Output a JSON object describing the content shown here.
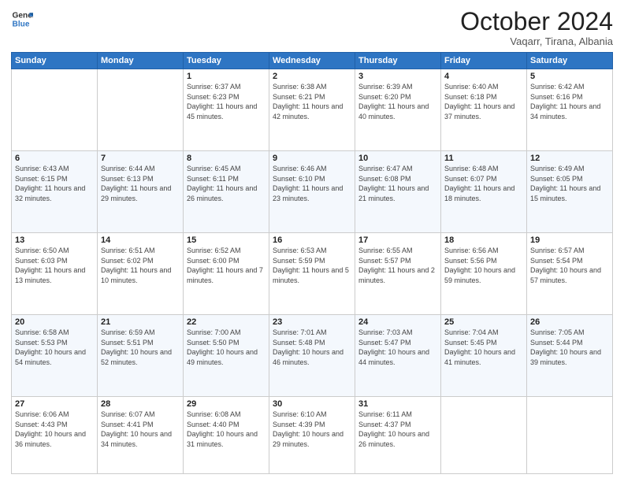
{
  "header": {
    "logo_line1": "General",
    "logo_line2": "Blue",
    "month_title": "October 2024",
    "subtitle": "Vaqarr, Tirana, Albania"
  },
  "weekdays": [
    "Sunday",
    "Monday",
    "Tuesday",
    "Wednesday",
    "Thursday",
    "Friday",
    "Saturday"
  ],
  "weeks": [
    [
      {
        "day": "",
        "sunrise": "",
        "sunset": "",
        "daylight": ""
      },
      {
        "day": "",
        "sunrise": "",
        "sunset": "",
        "daylight": ""
      },
      {
        "day": "1",
        "sunrise": "Sunrise: 6:37 AM",
        "sunset": "Sunset: 6:23 PM",
        "daylight": "Daylight: 11 hours and 45 minutes."
      },
      {
        "day": "2",
        "sunrise": "Sunrise: 6:38 AM",
        "sunset": "Sunset: 6:21 PM",
        "daylight": "Daylight: 11 hours and 42 minutes."
      },
      {
        "day": "3",
        "sunrise": "Sunrise: 6:39 AM",
        "sunset": "Sunset: 6:20 PM",
        "daylight": "Daylight: 11 hours and 40 minutes."
      },
      {
        "day": "4",
        "sunrise": "Sunrise: 6:40 AM",
        "sunset": "Sunset: 6:18 PM",
        "daylight": "Daylight: 11 hours and 37 minutes."
      },
      {
        "day": "5",
        "sunrise": "Sunrise: 6:42 AM",
        "sunset": "Sunset: 6:16 PM",
        "daylight": "Daylight: 11 hours and 34 minutes."
      }
    ],
    [
      {
        "day": "6",
        "sunrise": "Sunrise: 6:43 AM",
        "sunset": "Sunset: 6:15 PM",
        "daylight": "Daylight: 11 hours and 32 minutes."
      },
      {
        "day": "7",
        "sunrise": "Sunrise: 6:44 AM",
        "sunset": "Sunset: 6:13 PM",
        "daylight": "Daylight: 11 hours and 29 minutes."
      },
      {
        "day": "8",
        "sunrise": "Sunrise: 6:45 AM",
        "sunset": "Sunset: 6:11 PM",
        "daylight": "Daylight: 11 hours and 26 minutes."
      },
      {
        "day": "9",
        "sunrise": "Sunrise: 6:46 AM",
        "sunset": "Sunset: 6:10 PM",
        "daylight": "Daylight: 11 hours and 23 minutes."
      },
      {
        "day": "10",
        "sunrise": "Sunrise: 6:47 AM",
        "sunset": "Sunset: 6:08 PM",
        "daylight": "Daylight: 11 hours and 21 minutes."
      },
      {
        "day": "11",
        "sunrise": "Sunrise: 6:48 AM",
        "sunset": "Sunset: 6:07 PM",
        "daylight": "Daylight: 11 hours and 18 minutes."
      },
      {
        "day": "12",
        "sunrise": "Sunrise: 6:49 AM",
        "sunset": "Sunset: 6:05 PM",
        "daylight": "Daylight: 11 hours and 15 minutes."
      }
    ],
    [
      {
        "day": "13",
        "sunrise": "Sunrise: 6:50 AM",
        "sunset": "Sunset: 6:03 PM",
        "daylight": "Daylight: 11 hours and 13 minutes."
      },
      {
        "day": "14",
        "sunrise": "Sunrise: 6:51 AM",
        "sunset": "Sunset: 6:02 PM",
        "daylight": "Daylight: 11 hours and 10 minutes."
      },
      {
        "day": "15",
        "sunrise": "Sunrise: 6:52 AM",
        "sunset": "Sunset: 6:00 PM",
        "daylight": "Daylight: 11 hours and 7 minutes."
      },
      {
        "day": "16",
        "sunrise": "Sunrise: 6:53 AM",
        "sunset": "Sunset: 5:59 PM",
        "daylight": "Daylight: 11 hours and 5 minutes."
      },
      {
        "day": "17",
        "sunrise": "Sunrise: 6:55 AM",
        "sunset": "Sunset: 5:57 PM",
        "daylight": "Daylight: 11 hours and 2 minutes."
      },
      {
        "day": "18",
        "sunrise": "Sunrise: 6:56 AM",
        "sunset": "Sunset: 5:56 PM",
        "daylight": "Daylight: 10 hours and 59 minutes."
      },
      {
        "day": "19",
        "sunrise": "Sunrise: 6:57 AM",
        "sunset": "Sunset: 5:54 PM",
        "daylight": "Daylight: 10 hours and 57 minutes."
      }
    ],
    [
      {
        "day": "20",
        "sunrise": "Sunrise: 6:58 AM",
        "sunset": "Sunset: 5:53 PM",
        "daylight": "Daylight: 10 hours and 54 minutes."
      },
      {
        "day": "21",
        "sunrise": "Sunrise: 6:59 AM",
        "sunset": "Sunset: 5:51 PM",
        "daylight": "Daylight: 10 hours and 52 minutes."
      },
      {
        "day": "22",
        "sunrise": "Sunrise: 7:00 AM",
        "sunset": "Sunset: 5:50 PM",
        "daylight": "Daylight: 10 hours and 49 minutes."
      },
      {
        "day": "23",
        "sunrise": "Sunrise: 7:01 AM",
        "sunset": "Sunset: 5:48 PM",
        "daylight": "Daylight: 10 hours and 46 minutes."
      },
      {
        "day": "24",
        "sunrise": "Sunrise: 7:03 AM",
        "sunset": "Sunset: 5:47 PM",
        "daylight": "Daylight: 10 hours and 44 minutes."
      },
      {
        "day": "25",
        "sunrise": "Sunrise: 7:04 AM",
        "sunset": "Sunset: 5:45 PM",
        "daylight": "Daylight: 10 hours and 41 minutes."
      },
      {
        "day": "26",
        "sunrise": "Sunrise: 7:05 AM",
        "sunset": "Sunset: 5:44 PM",
        "daylight": "Daylight: 10 hours and 39 minutes."
      }
    ],
    [
      {
        "day": "27",
        "sunrise": "Sunrise: 6:06 AM",
        "sunset": "Sunset: 4:43 PM",
        "daylight": "Daylight: 10 hours and 36 minutes."
      },
      {
        "day": "28",
        "sunrise": "Sunrise: 6:07 AM",
        "sunset": "Sunset: 4:41 PM",
        "daylight": "Daylight: 10 hours and 34 minutes."
      },
      {
        "day": "29",
        "sunrise": "Sunrise: 6:08 AM",
        "sunset": "Sunset: 4:40 PM",
        "daylight": "Daylight: 10 hours and 31 minutes."
      },
      {
        "day": "30",
        "sunrise": "Sunrise: 6:10 AM",
        "sunset": "Sunset: 4:39 PM",
        "daylight": "Daylight: 10 hours and 29 minutes."
      },
      {
        "day": "31",
        "sunrise": "Sunrise: 6:11 AM",
        "sunset": "Sunset: 4:37 PM",
        "daylight": "Daylight: 10 hours and 26 minutes."
      },
      {
        "day": "",
        "sunrise": "",
        "sunset": "",
        "daylight": ""
      },
      {
        "day": "",
        "sunrise": "",
        "sunset": "",
        "daylight": ""
      }
    ]
  ]
}
